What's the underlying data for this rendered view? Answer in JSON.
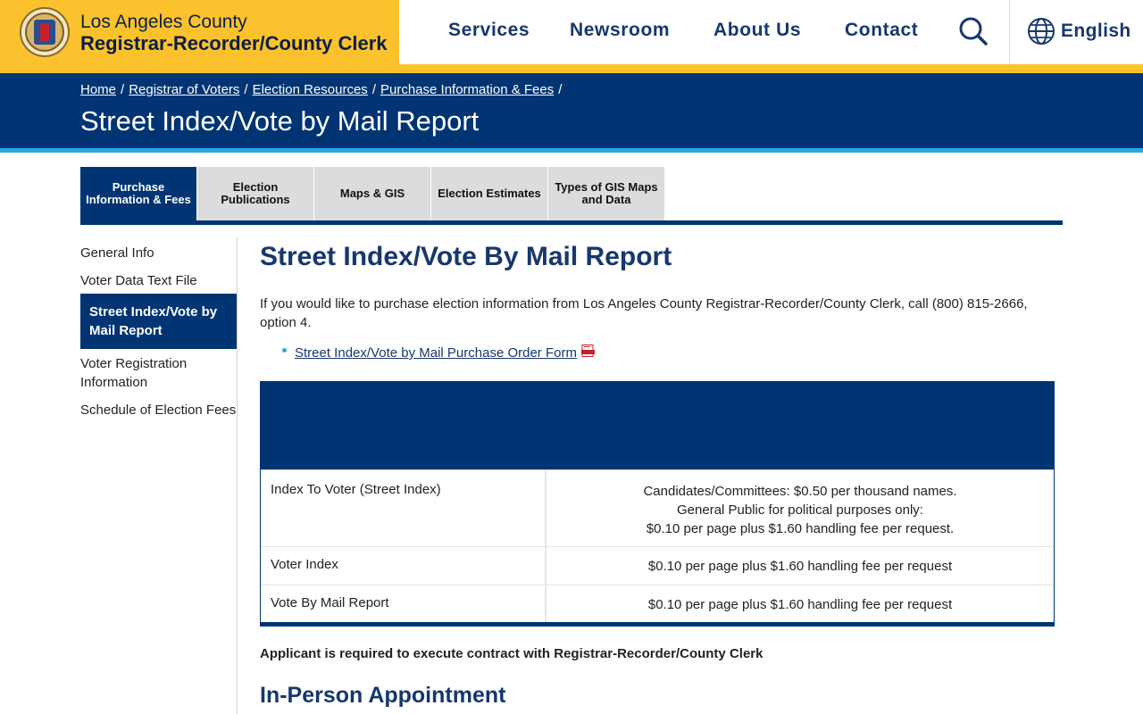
{
  "header": {
    "brand_line1": "Los Angeles County",
    "brand_line2": "Registrar-Recorder/County Clerk",
    "nav": [
      "Services",
      "Newsroom",
      "About Us",
      "Contact"
    ],
    "search_icon": "search-icon",
    "language": "English",
    "language_icon": "globe-icon"
  },
  "breadcrumb": [
    "Home",
    "Registrar of Voters",
    "Election Resources",
    "Purchase Information & Fees"
  ],
  "breadcrumb_separator": "/",
  "page_title": "Street Index/Vote by Mail Report",
  "tabs": [
    "Purchase Information & Fees",
    "Election Publications",
    "Maps & GIS",
    "Election Estimates",
    "Types of GIS Maps and Data"
  ],
  "active_tab": 0,
  "sidebar": [
    "General Info",
    "Voter Data Text File",
    "Street Index/Vote by Mail Report",
    "Voter Registration Information",
    "Schedule of Election Fees"
  ],
  "active_sidebar": 2,
  "main": {
    "heading": "Street Index/Vote By Mail Report",
    "intro": "If you would like to purchase election information from Los Angeles County Registrar-Recorder/County Clerk, call (800) 815-2666, option 4.",
    "link": "Street Index/Vote by Mail Purchase Order Form",
    "link_icon": "pdf-icon",
    "table": [
      {
        "item": "Index To Voter (Street Index)",
        "fee_lines": [
          "Candidates/Committees: $0.50 per thousand names.",
          "General Public for political purposes only:",
          "$0.10 per page plus $1.60 handling fee per request."
        ]
      },
      {
        "item": "Voter Index",
        "fee_lines": [
          "$0.10 per page plus $1.60 handling fee per request"
        ]
      },
      {
        "item": "Vote By Mail Report",
        "fee_lines": [
          "$0.10 per page plus $1.60 handling fee per request"
        ]
      }
    ],
    "notice": "Applicant is required to execute contract with Registrar-Recorder/County Clerk",
    "subheading": "In-Person Appointment"
  },
  "colors": {
    "brand_yellow": "#fcc22e",
    "navy": "#003473",
    "accent_blue": "#2da7df",
    "link_navy": "#17376e"
  }
}
